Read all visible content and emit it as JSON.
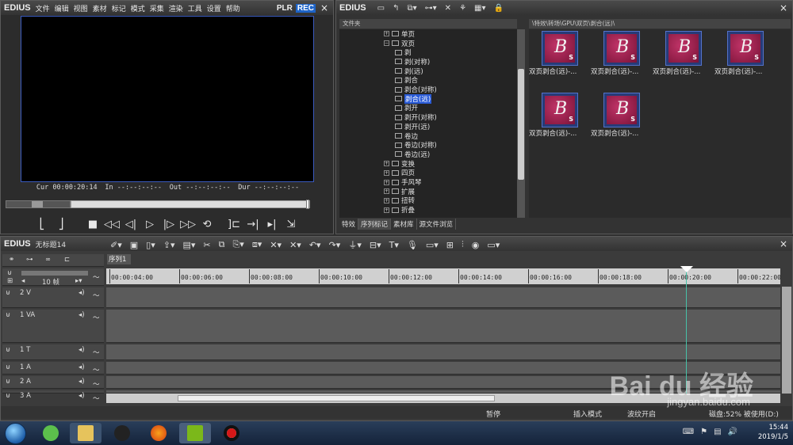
{
  "player": {
    "brand": "EDIUS",
    "menu": [
      "文件",
      "编辑",
      "视图",
      "素材",
      "标记",
      "模式",
      "采集",
      "渲染",
      "工具",
      "设置",
      "帮助"
    ],
    "plr": "PLR",
    "rec": "REC",
    "close": "×",
    "cur_label": "Cur",
    "cur_value": "00:00:20:14",
    "in_label": "In",
    "in_value": "--:--:--:--",
    "out_label": "Out",
    "out_value": "--:--:--:--",
    "dur_label": "Dur",
    "dur_value": "--:--:--:--"
  },
  "library": {
    "brand": "EDIUS",
    "close": "×",
    "tree_header": "文件夹",
    "path": "\\特效\\转场\\GPU\\双页\\剥合(远)\\",
    "tree": [
      {
        "label": "单页",
        "type": "folder",
        "indent": 0
      },
      {
        "label": "双页",
        "type": "folder-open",
        "indent": 0
      },
      {
        "label": "剥",
        "type": "fx",
        "indent": 1
      },
      {
        "label": "剥(对称)",
        "type": "fx",
        "indent": 1
      },
      {
        "label": "剥(远)",
        "type": "fx",
        "indent": 1
      },
      {
        "label": "剥合",
        "type": "fx",
        "indent": 1
      },
      {
        "label": "剥合(对称)",
        "type": "fx",
        "indent": 1
      },
      {
        "label": "剥合(远)",
        "type": "fx",
        "indent": 1,
        "selected": true
      },
      {
        "label": "剥开",
        "type": "fx",
        "indent": 1
      },
      {
        "label": "剥开(对称)",
        "type": "fx",
        "indent": 1
      },
      {
        "label": "剥开(远)",
        "type": "fx",
        "indent": 1
      },
      {
        "label": "卷边",
        "type": "fx",
        "indent": 1
      },
      {
        "label": "卷边(对称)",
        "type": "fx",
        "indent": 1
      },
      {
        "label": "卷边(远)",
        "type": "fx",
        "indent": 1
      },
      {
        "label": "变换",
        "type": "folder",
        "indent": 0
      },
      {
        "label": "四页",
        "type": "folder",
        "indent": 0
      },
      {
        "label": "手风琴",
        "type": "folder",
        "indent": 0
      },
      {
        "label": "扩展",
        "type": "folder",
        "indent": 0
      },
      {
        "label": "扭转",
        "type": "folder",
        "indent": 0
      },
      {
        "label": "折叠",
        "type": "folder",
        "indent": 0
      }
    ],
    "tabs": [
      "特效",
      "序列标记",
      "素材库",
      "源文件浏览"
    ],
    "thumbs": [
      {
        "caption": "双页剥合(远)-..."
      },
      {
        "caption": "双页剥合(远)-..."
      },
      {
        "caption": "双页剥合(远)-..."
      },
      {
        "caption": "双页剥合(远)-..."
      },
      {
        "caption": "双页剥合(远)-..."
      },
      {
        "caption": "双页剥合(远)-..."
      }
    ],
    "thumb_letter": "B",
    "thumb_badge": "S"
  },
  "timeline": {
    "brand": "EDIUS",
    "project": "无标题14",
    "close": "×",
    "sequence_tab": "序列1",
    "zoom": "10 帧",
    "ruler": [
      "00:00:04:00",
      "00:00:06:00",
      "00:00:08:00",
      "00:00:10:00",
      "00:00:12:00",
      "00:00:14:00",
      "00:00:16:00",
      "00:00:18:00",
      "00:00:20:00",
      "00:00:22:00"
    ],
    "tracks": [
      {
        "label": "2 V"
      },
      {
        "label": "1 VA"
      },
      {
        "label": "1 T"
      },
      {
        "label": "1 A"
      },
      {
        "label": "2 A"
      },
      {
        "label": "3 A"
      }
    ],
    "status": {
      "paused": "暂停",
      "insert_mode": "插入模式",
      "ripple": "波纹开启",
      "disk": "磁盘:52% 被使用(D:)"
    }
  },
  "taskbar": {
    "time": "15:44",
    "date": "2019/1/5"
  },
  "watermark": {
    "text": "Bai du 经验",
    "sub": "jingyan.baidu.com"
  }
}
